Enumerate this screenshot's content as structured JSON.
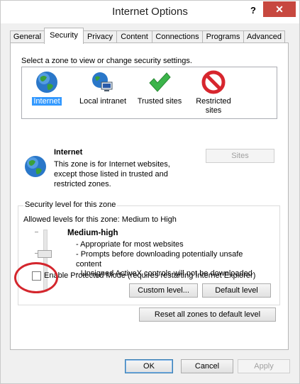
{
  "window": {
    "title": "Internet Options",
    "help_glyph": "?",
    "close_glyph": "✕"
  },
  "tabs": [
    "General",
    "Security",
    "Privacy",
    "Content",
    "Connections",
    "Programs",
    "Advanced"
  ],
  "security": {
    "select_zone_text": "Select a zone to view or change security settings.",
    "zones": [
      {
        "label": "Internet",
        "icon": "globe-icon"
      },
      {
        "label": "Local intranet",
        "icon": "intranet-icon"
      },
      {
        "label": "Trusted sites",
        "icon": "checkmark-icon"
      },
      {
        "label_line1": "Restricted",
        "label_line2": "sites",
        "icon": "restricted-icon"
      }
    ],
    "selected_zone": {
      "name": "Internet",
      "desc_line1": "This zone is for Internet websites,",
      "desc_line2": "except those listed in trusted and",
      "desc_line3": "restricted zones."
    },
    "sites_button": "Sites",
    "group_label": "Security level for this zone",
    "allowed_levels": "Allowed levels for this zone: Medium to High",
    "level_name": "Medium-high",
    "level_desc": [
      "- Appropriate for most websites",
      "- Prompts before downloading potentially unsafe",
      "content",
      "- Unsigned ActiveX controls will not be downloaded"
    ],
    "protected_mode_label": "Enable Protected Mode (requires restarting Internet Explorer)",
    "protected_mode_checked": false,
    "custom_level_button": "Custom level...",
    "default_level_button": "Default level",
    "reset_button": "Reset all zones to default level"
  },
  "footer": {
    "ok": "OK",
    "cancel": "Cancel",
    "apply": "Apply"
  },
  "colors": {
    "close_button": "#c7483f",
    "selection_blue": "#3399ff",
    "annotation_red": "#d4262d"
  }
}
